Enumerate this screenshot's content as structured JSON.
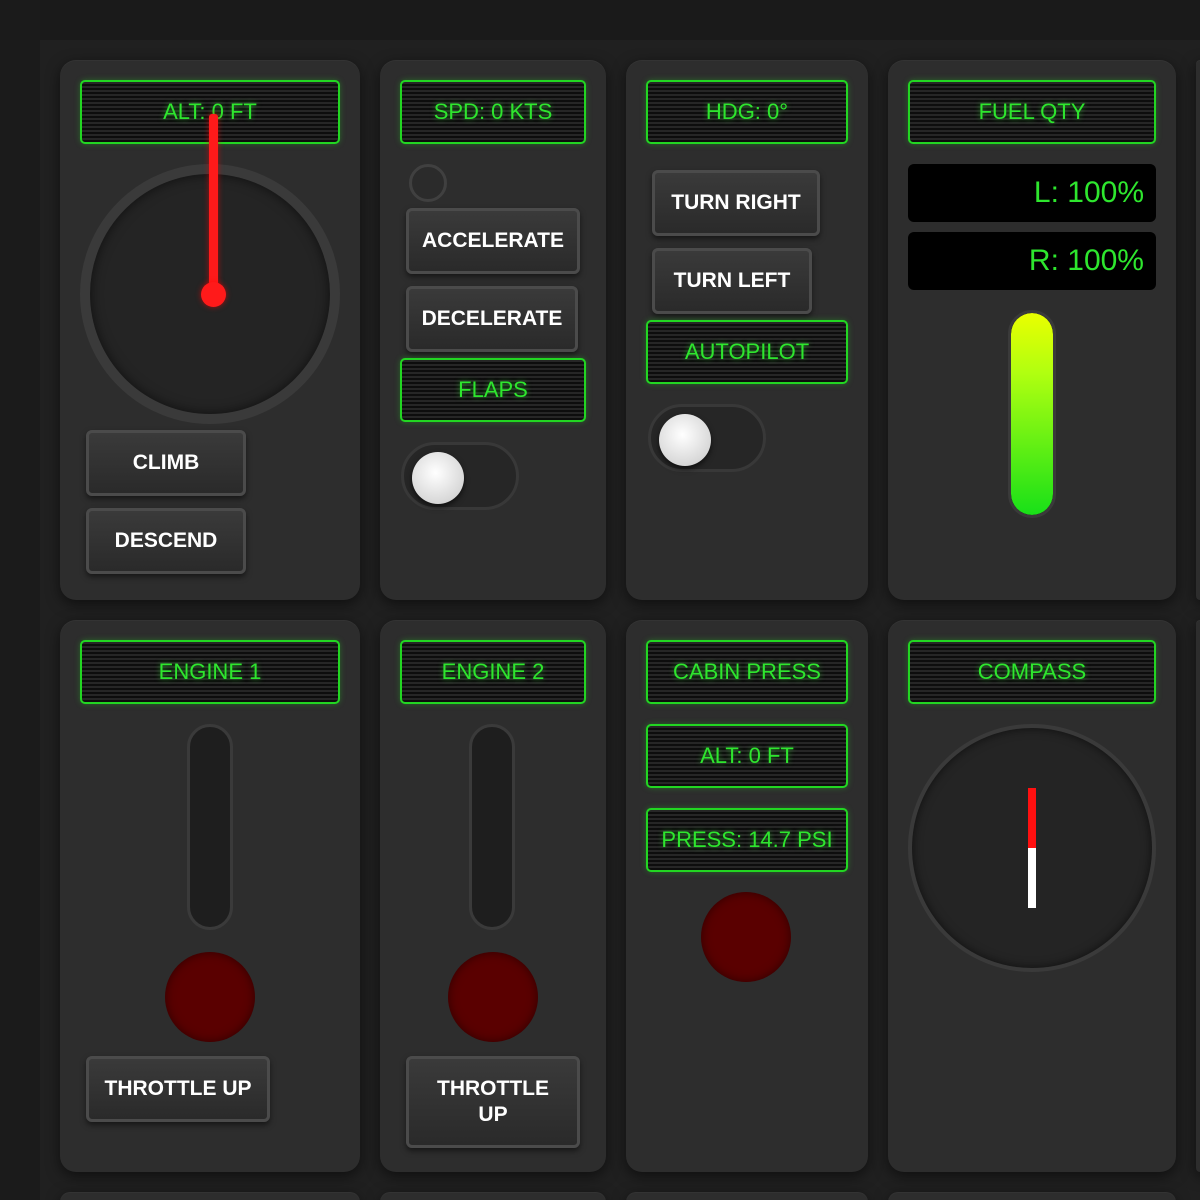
{
  "altitude_panel": {
    "display": "ALT: 0 FT",
    "climb_label": "CLIMB",
    "descend_label": "DESCEND"
  },
  "speed_panel": {
    "display": "SPD: 0 KTS",
    "accelerate_label": "ACCELERATE",
    "decelerate_label": "DECELERATE",
    "flaps_label": "FLAPS"
  },
  "heading_panel": {
    "display": "HDG: 0°",
    "turn_right_label": "TURN RIGHT",
    "turn_left_label": "TURN LEFT",
    "autopilot_label": "AUTOPILOT"
  },
  "fuel_panel": {
    "title": "FUEL QTY",
    "left": "L: 100%",
    "right": "R: 100%",
    "level_percent": 100
  },
  "engine1_panel": {
    "title": "ENGINE 1",
    "throttle_label": "THROTTLE UP"
  },
  "engine2_panel": {
    "title": "ENGINE 2",
    "throttle_label": "THROTTLE UP"
  },
  "cabin_panel": {
    "title": "CABIN PRESS",
    "altitude": "ALT: 0 FT",
    "pressure": "PRESS: 14.7 PSI"
  },
  "compass_panel": {
    "title": "COMPASS"
  },
  "colors": {
    "lcd_green": "#2ee62e",
    "needle_red": "#ff1a1a",
    "warning_dark_red": "#5a0000",
    "fuel_top": "#eaff00",
    "fuel_bottom": "#18e018"
  }
}
